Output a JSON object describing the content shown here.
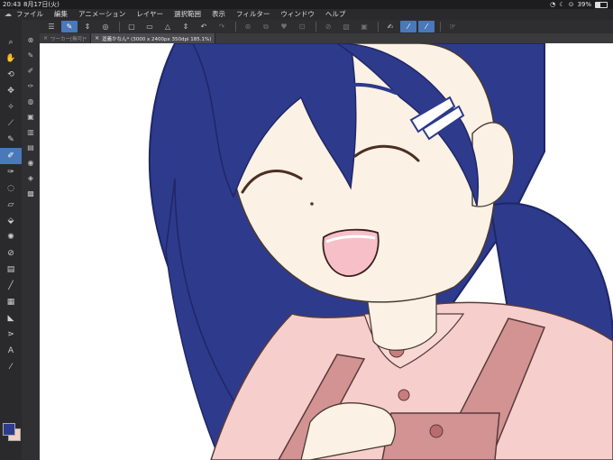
{
  "status": {
    "time": "20:43",
    "date": "8月17日(火)",
    "battery_percent": 39,
    "battery_label": "39%",
    "wifi_icon": "wifi-icon",
    "icons": [
      "dnd-moon-icon",
      "orientation-lock-icon"
    ]
  },
  "menu": {
    "items": [
      "ファイル",
      "編集",
      "アニメーション",
      "レイヤー",
      "選択範囲",
      "表示",
      "フィルター",
      "ウィンドウ",
      "ヘルプ"
    ]
  },
  "tabs": [
    {
      "label": "ワーカー[無可]*"
    },
    {
      "label": "逗義かなん* (3000 x 2400px 350dpi 185.1%)"
    }
  ],
  "colors": {
    "main_color": "#2c3b8e",
    "sub_color": "#f2d0c0",
    "accent": "#4a78b8",
    "hair": "#2e3a8c",
    "skin": "#fbf1e4",
    "shirt": "#f6cfcc",
    "overalls": "#d29392",
    "mouth": "#f7c0c8"
  },
  "toolbar_icons": [
    "menu-icon",
    "pen-pressure-icon",
    "chevron-updown-icon",
    "layer-icon",
    "new-file-icon",
    "open-folder-icon",
    "save-icon",
    "chevron-updown-icon",
    "undo-icon",
    "redo-icon",
    "clear-icon",
    "transform-icon",
    "fill-icon",
    "move-icon",
    "selection-icon",
    "deselect-icon",
    "invert-icon",
    "crop-icon",
    "vector-pen-icon",
    "smooth-pen-icon",
    "pressure-pen-icon",
    "gesture-icon"
  ],
  "left_tools": [
    "zoom-icon",
    "hand-icon",
    "rotate-icon",
    "move-layer-icon",
    "magic-wand-icon",
    "eyedropper-icon",
    "pen-icon",
    "brush-icon",
    "airbrush-icon",
    "lasso-icon",
    "eraser-icon",
    "fill-bucket-icon",
    "blend-icon",
    "ruler-icon",
    "figure-icon",
    "text-icon",
    "balloon-icon",
    "line-correct-icon",
    "color-icon"
  ],
  "sub_tools": [
    "navigator-icon",
    "subtool-pen-icon",
    "subtool-marker-icon",
    "subtool-ink-icon",
    "subtool-brush-icon",
    "subtool-texture-icon",
    "subtool-decor-icon",
    "subtool-list-icon",
    "subtool-layer-icon",
    "subtool-material-icon"
  ]
}
